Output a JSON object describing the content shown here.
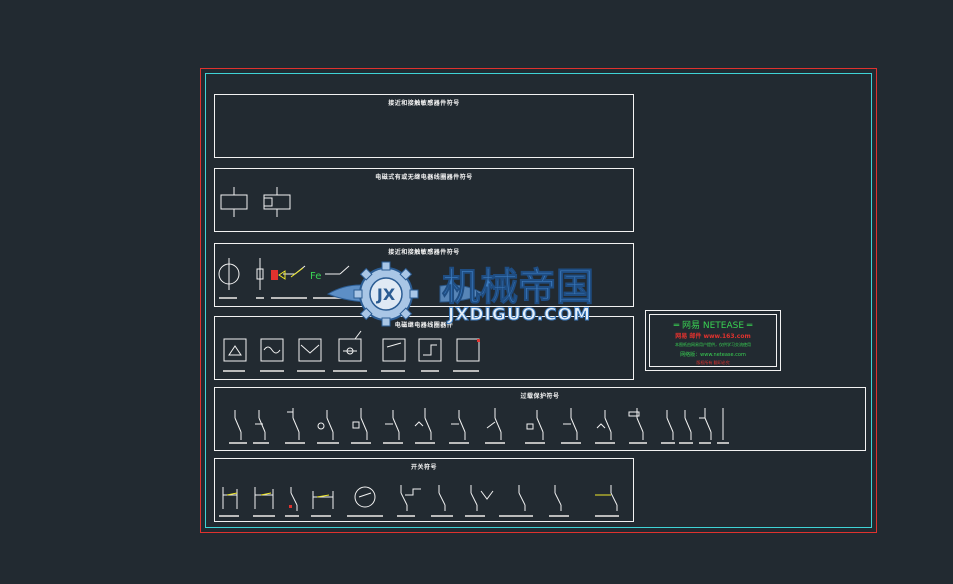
{
  "panels": {
    "p1_title": "接近和接触敏感器件符号",
    "p2_title": "电磁式有或无继电器线圈器件符号",
    "p3_title": "接近和接触敏感器件符号",
    "p4_title": "电磁继电器线圈器件",
    "p5_title": "过载保护符号",
    "p6_title": "开关符号",
    "p3_fe_label": "Fe"
  },
  "netease": {
    "title": "═ 网易 NETEASE ═",
    "line1": "网易 邮件 www.163.com",
    "line2": "本图纸由网易用户提供，仅供学习交流使用",
    "line3": "网络版：www.netease.com",
    "line4": "版权所有 翻印必究"
  },
  "watermark": {
    "cn": "机械帝国",
    "en": "JXDIGUO.COM",
    "logo_letters": "JX"
  },
  "colors": {
    "background": "#222a31",
    "frame_red": "#e0322e",
    "frame_cyan": "#3fd3d6",
    "line": "#f2f2f2",
    "yellow": "#f0e82a",
    "red": "#e0322e",
    "green": "#39d353",
    "watermark_blue": "#3c7bbf"
  }
}
